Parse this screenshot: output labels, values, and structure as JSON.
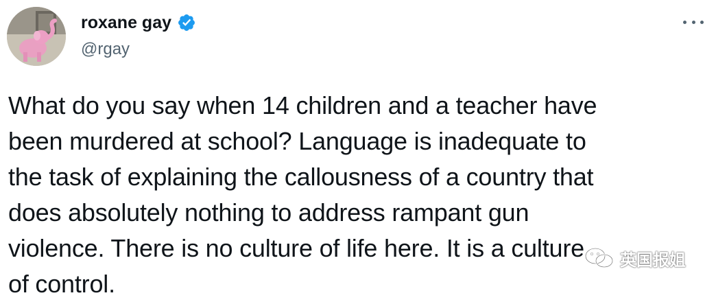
{
  "tweet": {
    "author": {
      "display_name": "roxane gay",
      "handle": "@rgay",
      "verified": true,
      "avatar_icon": "pink-elephant-avatar-icon"
    },
    "more_icon": "ellipsis-icon",
    "text": "What do you say when 14 children and a teacher have\nbeen murdered at school? Language is inadequate to\nthe task of explaining the callousness of a country that\ndoes absolutely nothing to address rampant gun\nviolence. There is no culture of life here. It is a culture\nof control."
  },
  "watermark": {
    "text": "英国报姐",
    "icon": "wechat-logo-icon"
  },
  "colors": {
    "text_primary": "#0f1419",
    "text_secondary": "#536471",
    "verified_blue": "#1d9bf0",
    "background": "#ffffff"
  }
}
